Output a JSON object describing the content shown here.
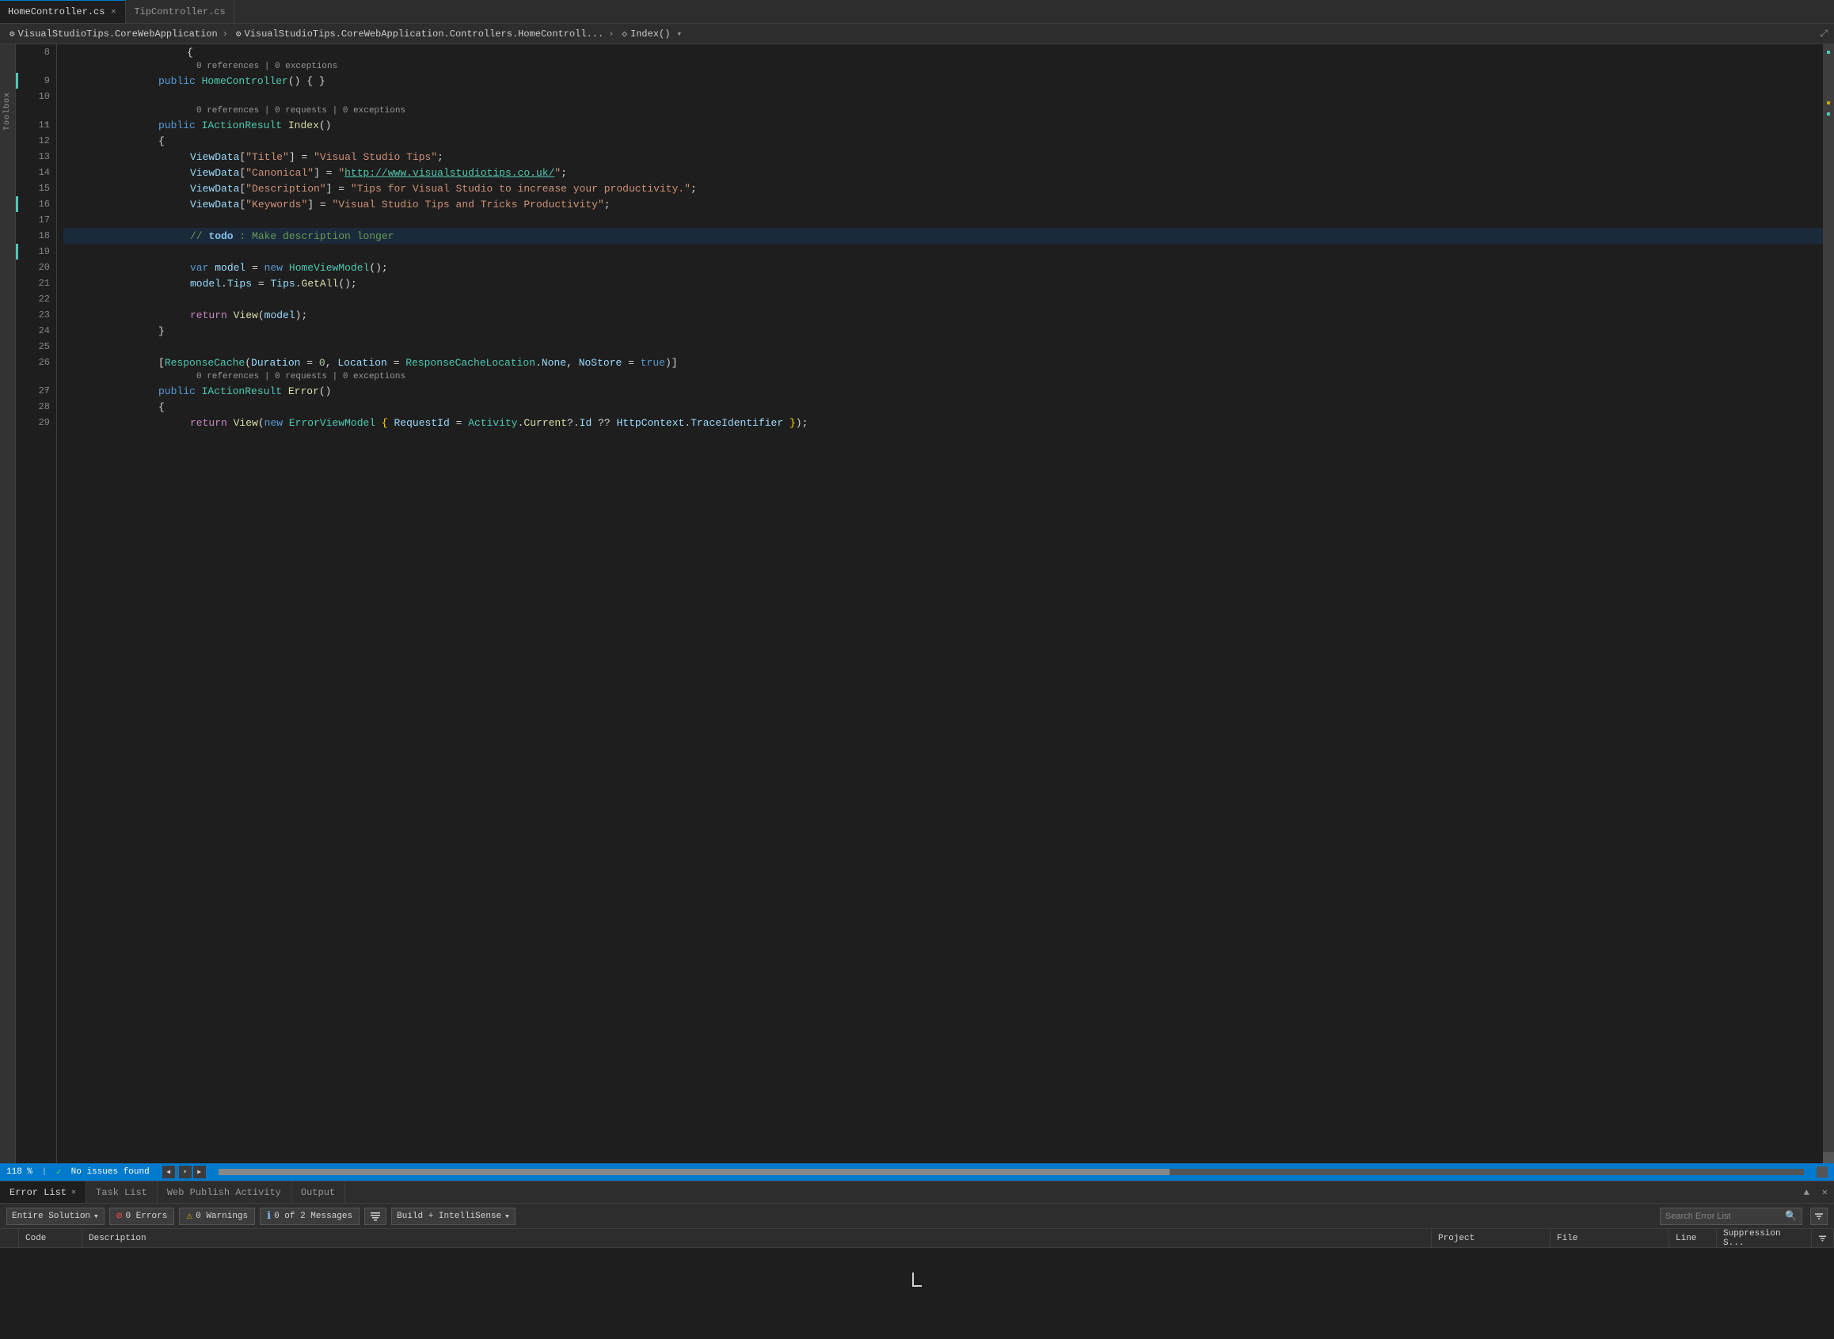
{
  "tabs": [
    {
      "id": "homecontroller",
      "label": "HomeController.cs",
      "active": true,
      "has_close": true
    },
    {
      "id": "tipcontroller",
      "label": "TipController.cs",
      "active": false,
      "has_close": false
    }
  ],
  "breadcrumb": {
    "items": [
      {
        "icon": "⚙",
        "label": "VisualStudioTips.CoreWebApplication"
      },
      {
        "icon": "⚙",
        "label": "VisualStudioTips.CoreWebApplication.Controllers.HomeControll..."
      },
      {
        "icon": "◇",
        "label": "Index()"
      }
    ]
  },
  "code_lines": [
    {
      "num": 8,
      "indent": 2,
      "content_type": "plain",
      "content": "            {"
    },
    {
      "num": 8,
      "meta": "0 references | 0 exceptions",
      "content_type": "meta"
    },
    {
      "num": 9,
      "content_type": "code",
      "raw": "            public HomeController() { }"
    },
    {
      "num": 10,
      "content_type": "empty"
    },
    {
      "num": 10,
      "meta": "0 references | 0 requests | 0 exceptions",
      "content_type": "meta"
    },
    {
      "num": 11,
      "content_type": "code",
      "raw": "            public IActionResult Index()"
    },
    {
      "num": 12,
      "content_type": "code",
      "raw": "            {"
    },
    {
      "num": 13,
      "content_type": "code",
      "raw": "                ViewData[\"Title\"] = \"Visual Studio Tips\";"
    },
    {
      "num": 14,
      "content_type": "code",
      "raw": "                ViewData[\"Canonical\"] = \"http://www.visualstudiotips.co.uk/\";"
    },
    {
      "num": 15,
      "content_type": "code",
      "raw": "                ViewData[\"Description\"] = \"Tips for Visual Studio to increase your productivity.\";"
    },
    {
      "num": 16,
      "content_type": "code",
      "raw": "                ViewData[\"Keywords\"] = \"Visual Studio Tips and Tricks Productivity\";"
    },
    {
      "num": 17,
      "content_type": "empty"
    },
    {
      "num": 18,
      "content_type": "todo",
      "raw": "                // todo : Make description longer"
    },
    {
      "num": 19,
      "content_type": "empty"
    },
    {
      "num": 20,
      "content_type": "code",
      "raw": "                var model = new HomeViewModel();"
    },
    {
      "num": 21,
      "content_type": "code",
      "raw": "                model.Tips = Tips.GetAll();"
    },
    {
      "num": 22,
      "content_type": "empty"
    },
    {
      "num": 23,
      "content_type": "code",
      "raw": "                return View(model);"
    },
    {
      "num": 24,
      "content_type": "code",
      "raw": "            }"
    },
    {
      "num": 25,
      "content_type": "empty"
    },
    {
      "num": 26,
      "content_type": "attribute",
      "raw": "            [ResponseCache(Duration = 0, Location = ResponseCacheLocation.None, NoStore = true)]"
    },
    {
      "num": 26,
      "meta": "0 references | 0 requests | 0 exceptions",
      "content_type": "meta"
    },
    {
      "num": 27,
      "content_type": "code",
      "raw": "            public IActionResult Error()"
    },
    {
      "num": 28,
      "content_type": "code",
      "raw": "            {"
    },
    {
      "num": 29,
      "content_type": "code",
      "raw": "                return View(new ErrorViewModel { RequestId = Activity.Current?.Id ?? HttpContext.TraceIdentifier });"
    }
  ],
  "status_bar": {
    "zoom": "118 %",
    "no_issues": "No issues found",
    "nav_arrows": [
      "◀",
      "▶"
    ]
  },
  "bottom_panel": {
    "tabs": [
      {
        "label": "Error List",
        "active": true,
        "has_close": true
      },
      {
        "label": "Task List",
        "active": false
      },
      {
        "label": "Web Publish Activity",
        "active": false
      },
      {
        "label": "Output",
        "active": false
      }
    ],
    "toolbar": {
      "solution_dropdown": "Entire Solution",
      "errors_btn": "0 Errors",
      "warnings_btn": "0 Warnings",
      "messages_btn": "0 of 2 Messages",
      "build_dropdown": "Build + IntelliSense",
      "search_placeholder": "Search Error List"
    },
    "grid_headers": [
      "",
      "Code",
      "Description",
      "Project",
      "File",
      "Line",
      "Suppression S..."
    ],
    "cursor_symbol": "⊘"
  },
  "side_labels": [
    "Toolbox"
  ]
}
